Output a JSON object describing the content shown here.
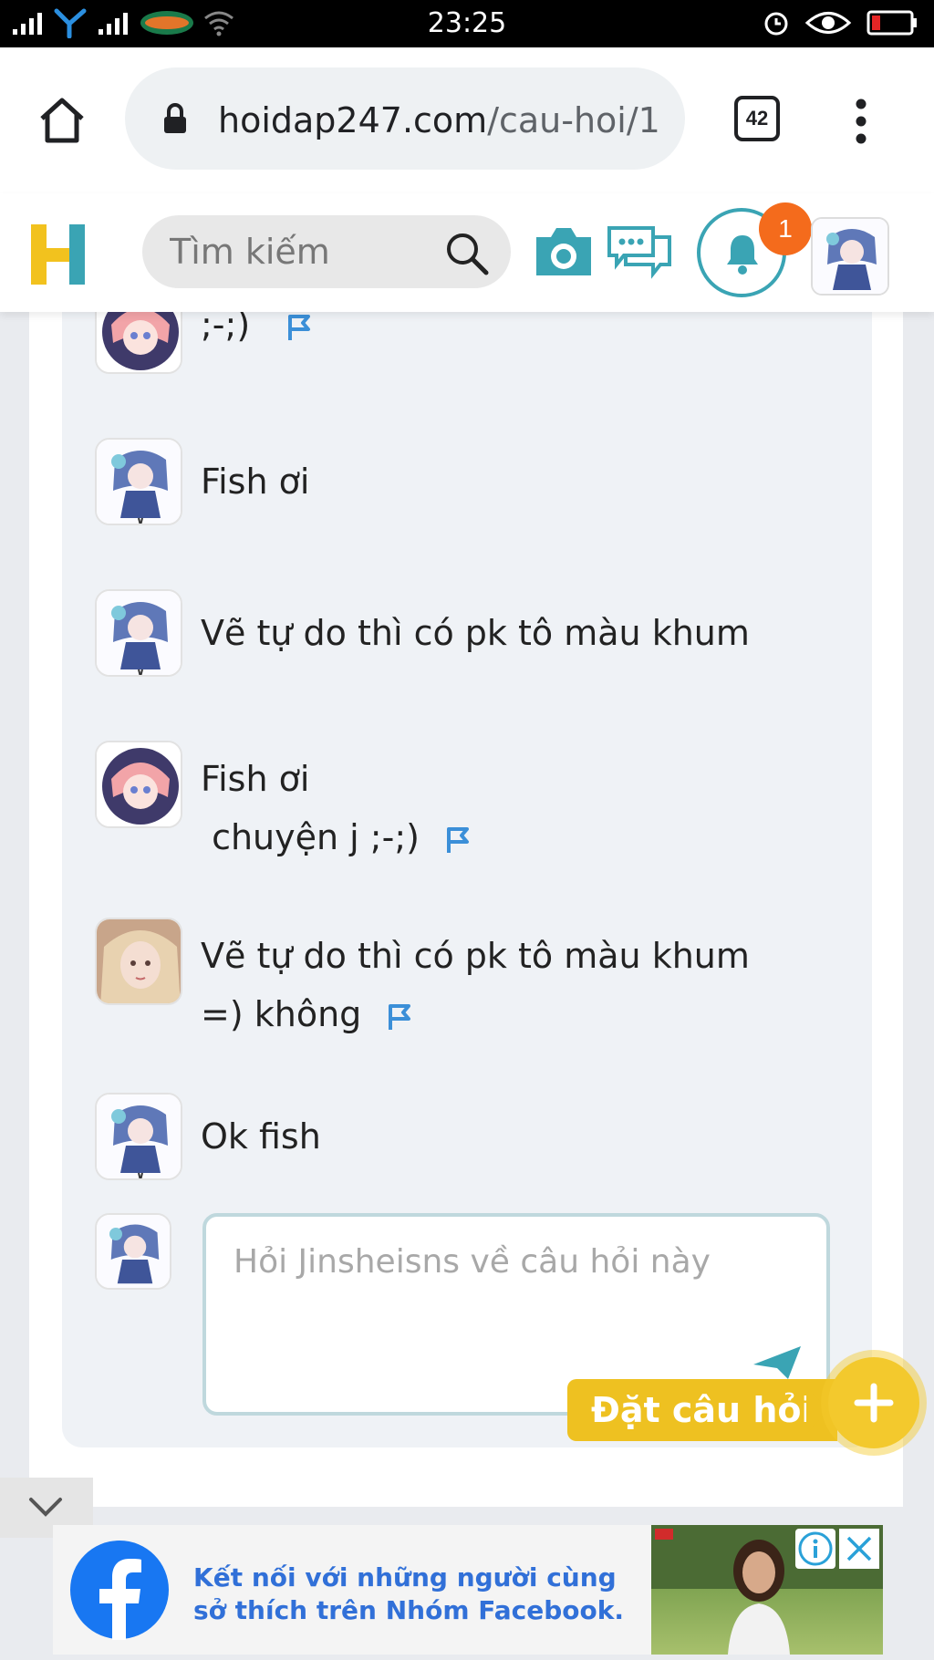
{
  "status_bar": {
    "time": "23:25"
  },
  "browser": {
    "url_host": "hoidap247.com",
    "url_path": "/cau-hoi/1",
    "tab_count": "42"
  },
  "header": {
    "search_placeholder": "Tìm kiếm",
    "notification_count": "1"
  },
  "messages": [
    {
      "avatar": "anime-girl-pink-avatar",
      "lines": [
        ";-;)"
      ],
      "has_flag": true
    },
    {
      "avatar": "anime-girl-blue-avatar",
      "lines": [
        "Fish ơi"
      ],
      "has_flag": false
    },
    {
      "avatar": "anime-girl-blue-avatar",
      "lines": [
        "Vẽ tự do thì có pk tô màu khum"
      ],
      "has_flag": false
    },
    {
      "avatar": "anime-girl-pink-avatar",
      "lines": [
        "Fish ơi",
        " chuyện j ;-;)"
      ],
      "has_flag": true
    },
    {
      "avatar": "doll-girl-avatar",
      "lines": [
        "Vẽ tự do thì có pk tô màu khum",
        "=) không"
      ],
      "has_flag": true
    },
    {
      "avatar": "anime-girl-blue-avatar",
      "lines": [
        "Ok fish"
      ],
      "has_flag": false
    }
  ],
  "reply": {
    "placeholder": "Hỏi Jinsheisns về câu hỏi này"
  },
  "ask_button": {
    "label": "Đặt câu hỏi"
  },
  "ad": {
    "line1": "Kết nối với những người cùng",
    "line2": "sở thích trên Nhóm Facebook."
  },
  "colors": {
    "brand_teal": "#3aa4b4",
    "brand_yellow": "#eec121",
    "badge_orange": "#f46b1c",
    "flag_blue": "#3b8fd8",
    "facebook_blue": "#1877f2"
  }
}
